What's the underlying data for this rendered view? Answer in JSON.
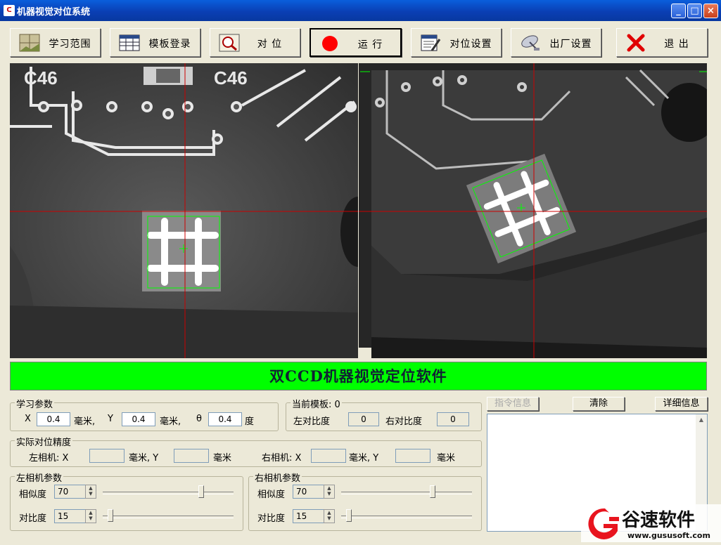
{
  "window": {
    "title": "机器视觉对位系统",
    "app_icon": "app-icon",
    "buttons": [
      "minimize-icon",
      "maximize-icon",
      "close-icon"
    ]
  },
  "toolbar": [
    {
      "key": "learn",
      "label": "学习范围",
      "icon": "learn-range-icon"
    },
    {
      "key": "template",
      "label": "模板登录",
      "icon": "template-table-icon"
    },
    {
      "key": "align",
      "label": "对 位",
      "icon": "magnifier-icon"
    },
    {
      "key": "run",
      "label": "运 行",
      "icon": "record-dot-icon",
      "pressed": true,
      "icon_color": "#ff0000"
    },
    {
      "key": "align_settings",
      "label": "对位设置",
      "icon": "settings-document-icon"
    },
    {
      "key": "factory_settings",
      "label": "出厂设置",
      "icon": "satellite-dish-icon"
    },
    {
      "key": "exit",
      "label": "退 出",
      "icon": "red-x-icon",
      "icon_color": "#e00000"
    }
  ],
  "banner": {
    "text": "双CCD机器视觉定位软件",
    "color": "#00ff00"
  },
  "learn_params": {
    "title": "学习参数",
    "x_label": "X",
    "x_value": "0.4",
    "x_unit": "毫米,",
    "y_label": "Y",
    "y_value": "0.4",
    "y_unit": "毫米,",
    "theta_label": "θ",
    "theta_value": "0.4",
    "theta_unit": "度"
  },
  "current_template": {
    "title": "当前模板: 0",
    "left_contrast_label": "左对比度",
    "left_contrast_value": "0",
    "right_contrast_label": "右对比度",
    "right_contrast_value": "0"
  },
  "actual_precision": {
    "title": "实际对位精度",
    "left_label": "左相机: X",
    "left_mm1": "毫米, Y",
    "left_mm2": "毫米",
    "right_label": "右相机: X",
    "right_mm1": "毫米, Y",
    "right_mm2": "毫米"
  },
  "left_camera": {
    "title": "左相机参数",
    "similarity_label": "相似度",
    "similarity_value": "70",
    "similarity_level": 0.75,
    "contrast_label": "对比度",
    "contrast_value": "15",
    "contrast_level": 0.06
  },
  "right_camera": {
    "title": "右相机参数",
    "similarity_label": "相似度",
    "similarity_value": "70",
    "similarity_level": 0.7,
    "contrast_label": "对比度",
    "contrast_value": "15",
    "contrast_level": 0.06
  },
  "log_panel": {
    "info_label": "指令信息",
    "clear_label": "清除",
    "detail_label": "详细信息"
  },
  "watermark": {
    "brand": "谷速软件",
    "url": "www.gususoft.com"
  },
  "colors": {
    "crosshair": "#cc0000",
    "roi": "#00ff00",
    "window_bg": "#ece9d8"
  }
}
